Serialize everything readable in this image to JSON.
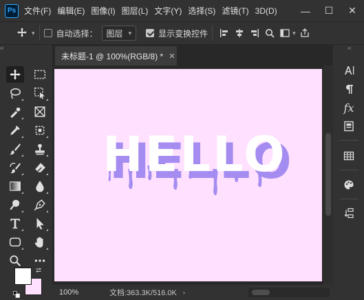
{
  "app": {
    "logo": "Ps"
  },
  "menu": [
    "文件(F)",
    "编辑(E)",
    "图像(I)",
    "图层(L)",
    "文字(Y)",
    "选择(S)",
    "滤镜(T)",
    "3D(D)"
  ],
  "window_controls": {
    "minimize": "—",
    "maximize": "☐",
    "close": "✕"
  },
  "options": {
    "auto_select_label": "自动选择：",
    "auto_select_checked": false,
    "auto_select_target": "图层",
    "show_transform_label": "显示变换控件",
    "show_transform_checked": true
  },
  "document": {
    "tab_title": "未标题-1 @ 100%(RGB/8) *",
    "close": "✕",
    "canvas_color": "#ffe0ff",
    "text": "HELLO",
    "text_color": "#ffffff",
    "shadow_color": "#a48cf0"
  },
  "status": {
    "zoom": "100%",
    "doc_info": "文档:363.3K/516.0K",
    "arrow": "›"
  },
  "colors": {
    "foreground": "#ffffff",
    "background": "#ffe0ff"
  },
  "collapse_arrows": {
    "left": "‹‹",
    "right": "‹‹"
  }
}
